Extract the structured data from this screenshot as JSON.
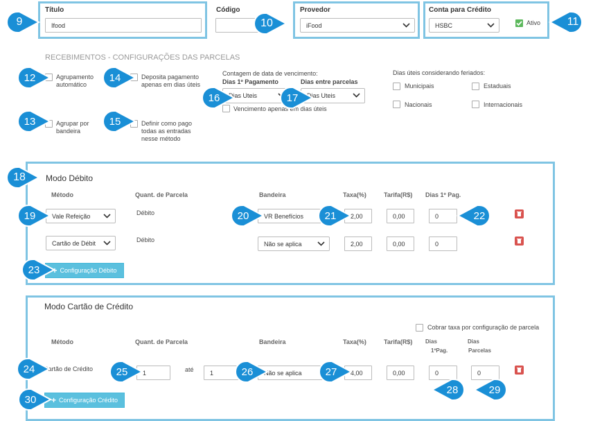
{
  "header": {
    "titulo_label": "Título",
    "titulo_value": "Ifood",
    "codigo_label": "Código",
    "codigo_value": "",
    "provedor_label": "Provedor",
    "provedor_value": "iFood",
    "conta_label": "Conta para Crédito",
    "conta_value": "HSBC",
    "ativo_label": "Ativo"
  },
  "recebimentos": {
    "title": "RECEBIMENTOS - CONFIGURAÇÕES DAS PARCELAS",
    "agrupamento": "Agrupamento automático",
    "deposita": "Deposita pagamento apenas em dias úteis",
    "agrupar": "Agrupar por bandeira",
    "definir": "Definir como pago todas as entradas nesse método",
    "contagem_label": "Contagem de data de vencimento:",
    "dias1_label": "Dias 1º Pagamento",
    "dias_entre_label": "Dias entre parcelas",
    "dias1_value": "Dias Uteis",
    "dias_entre_value": "Dias Uteis",
    "vencimento_label": "Vencimento apenas em dias úteis",
    "feriados_label": "Dias úteis considerando feriados:",
    "municipais": "Municipais",
    "estaduais": "Estaduais",
    "nacionais": "Nacionais",
    "internacionais": "Internacionais"
  },
  "debito": {
    "title": "Modo Débito",
    "col_metodo": "Método",
    "col_quant": "Quant. de Parcela",
    "col_bandeira": "Bandeira",
    "col_taxa": "Taxa(%)",
    "col_tarifa": "Tarifa(R$)",
    "col_dias": "Dias 1º Pag.",
    "rows": [
      {
        "metodo": "Vale Refeição",
        "quant": "Débito",
        "bandeira": "VR Benefícios",
        "taxa": "2,00",
        "tarifa": "0,00",
        "dias": "0"
      },
      {
        "metodo": "Cartão de Débit",
        "quant": "Débito",
        "bandeira": "Não se aplica",
        "taxa": "2,00",
        "tarifa": "0,00",
        "dias": "0"
      }
    ],
    "button": "Configuração Débito"
  },
  "credito": {
    "title": "Modo Cartão de Crédito",
    "cobrar_label": "Cobrar taxa por configuração de parcela",
    "col_metodo": "Método",
    "col_quant": "Quant. de Parcela",
    "col_bandeira": "Bandeira",
    "col_taxa": "Taxa(%)",
    "col_tarifa": "Tarifa(R$)",
    "col_dias1": "Dias\n1ºPag.",
    "col_dias1_a": "Dias",
    "col_dias1_b": "1ºPag.",
    "col_diasp_a": "Dias",
    "col_diasp_b": "Parcelas",
    "metodo": "Cartão de Crédito",
    "de": "1",
    "ate_label": "até",
    "ate": "1",
    "bandeira": "Não se aplica",
    "taxa": "4,00",
    "tarifa": "0,00",
    "dias1": "0",
    "diasp": "0",
    "button": "Configuração Crédito"
  },
  "badges": [
    "9",
    "10",
    "11",
    "12",
    "13",
    "14",
    "15",
    "16",
    "17",
    "18",
    "19",
    "20",
    "21",
    "22",
    "23",
    "24",
    "25",
    "26",
    "27",
    "28",
    "29",
    "30"
  ],
  "colors": {
    "highlight": "#7fc4e3",
    "badge": "#1a8fd6",
    "button": "#5bc0de",
    "trash": "#d9534f",
    "check": "#5cb85c"
  }
}
